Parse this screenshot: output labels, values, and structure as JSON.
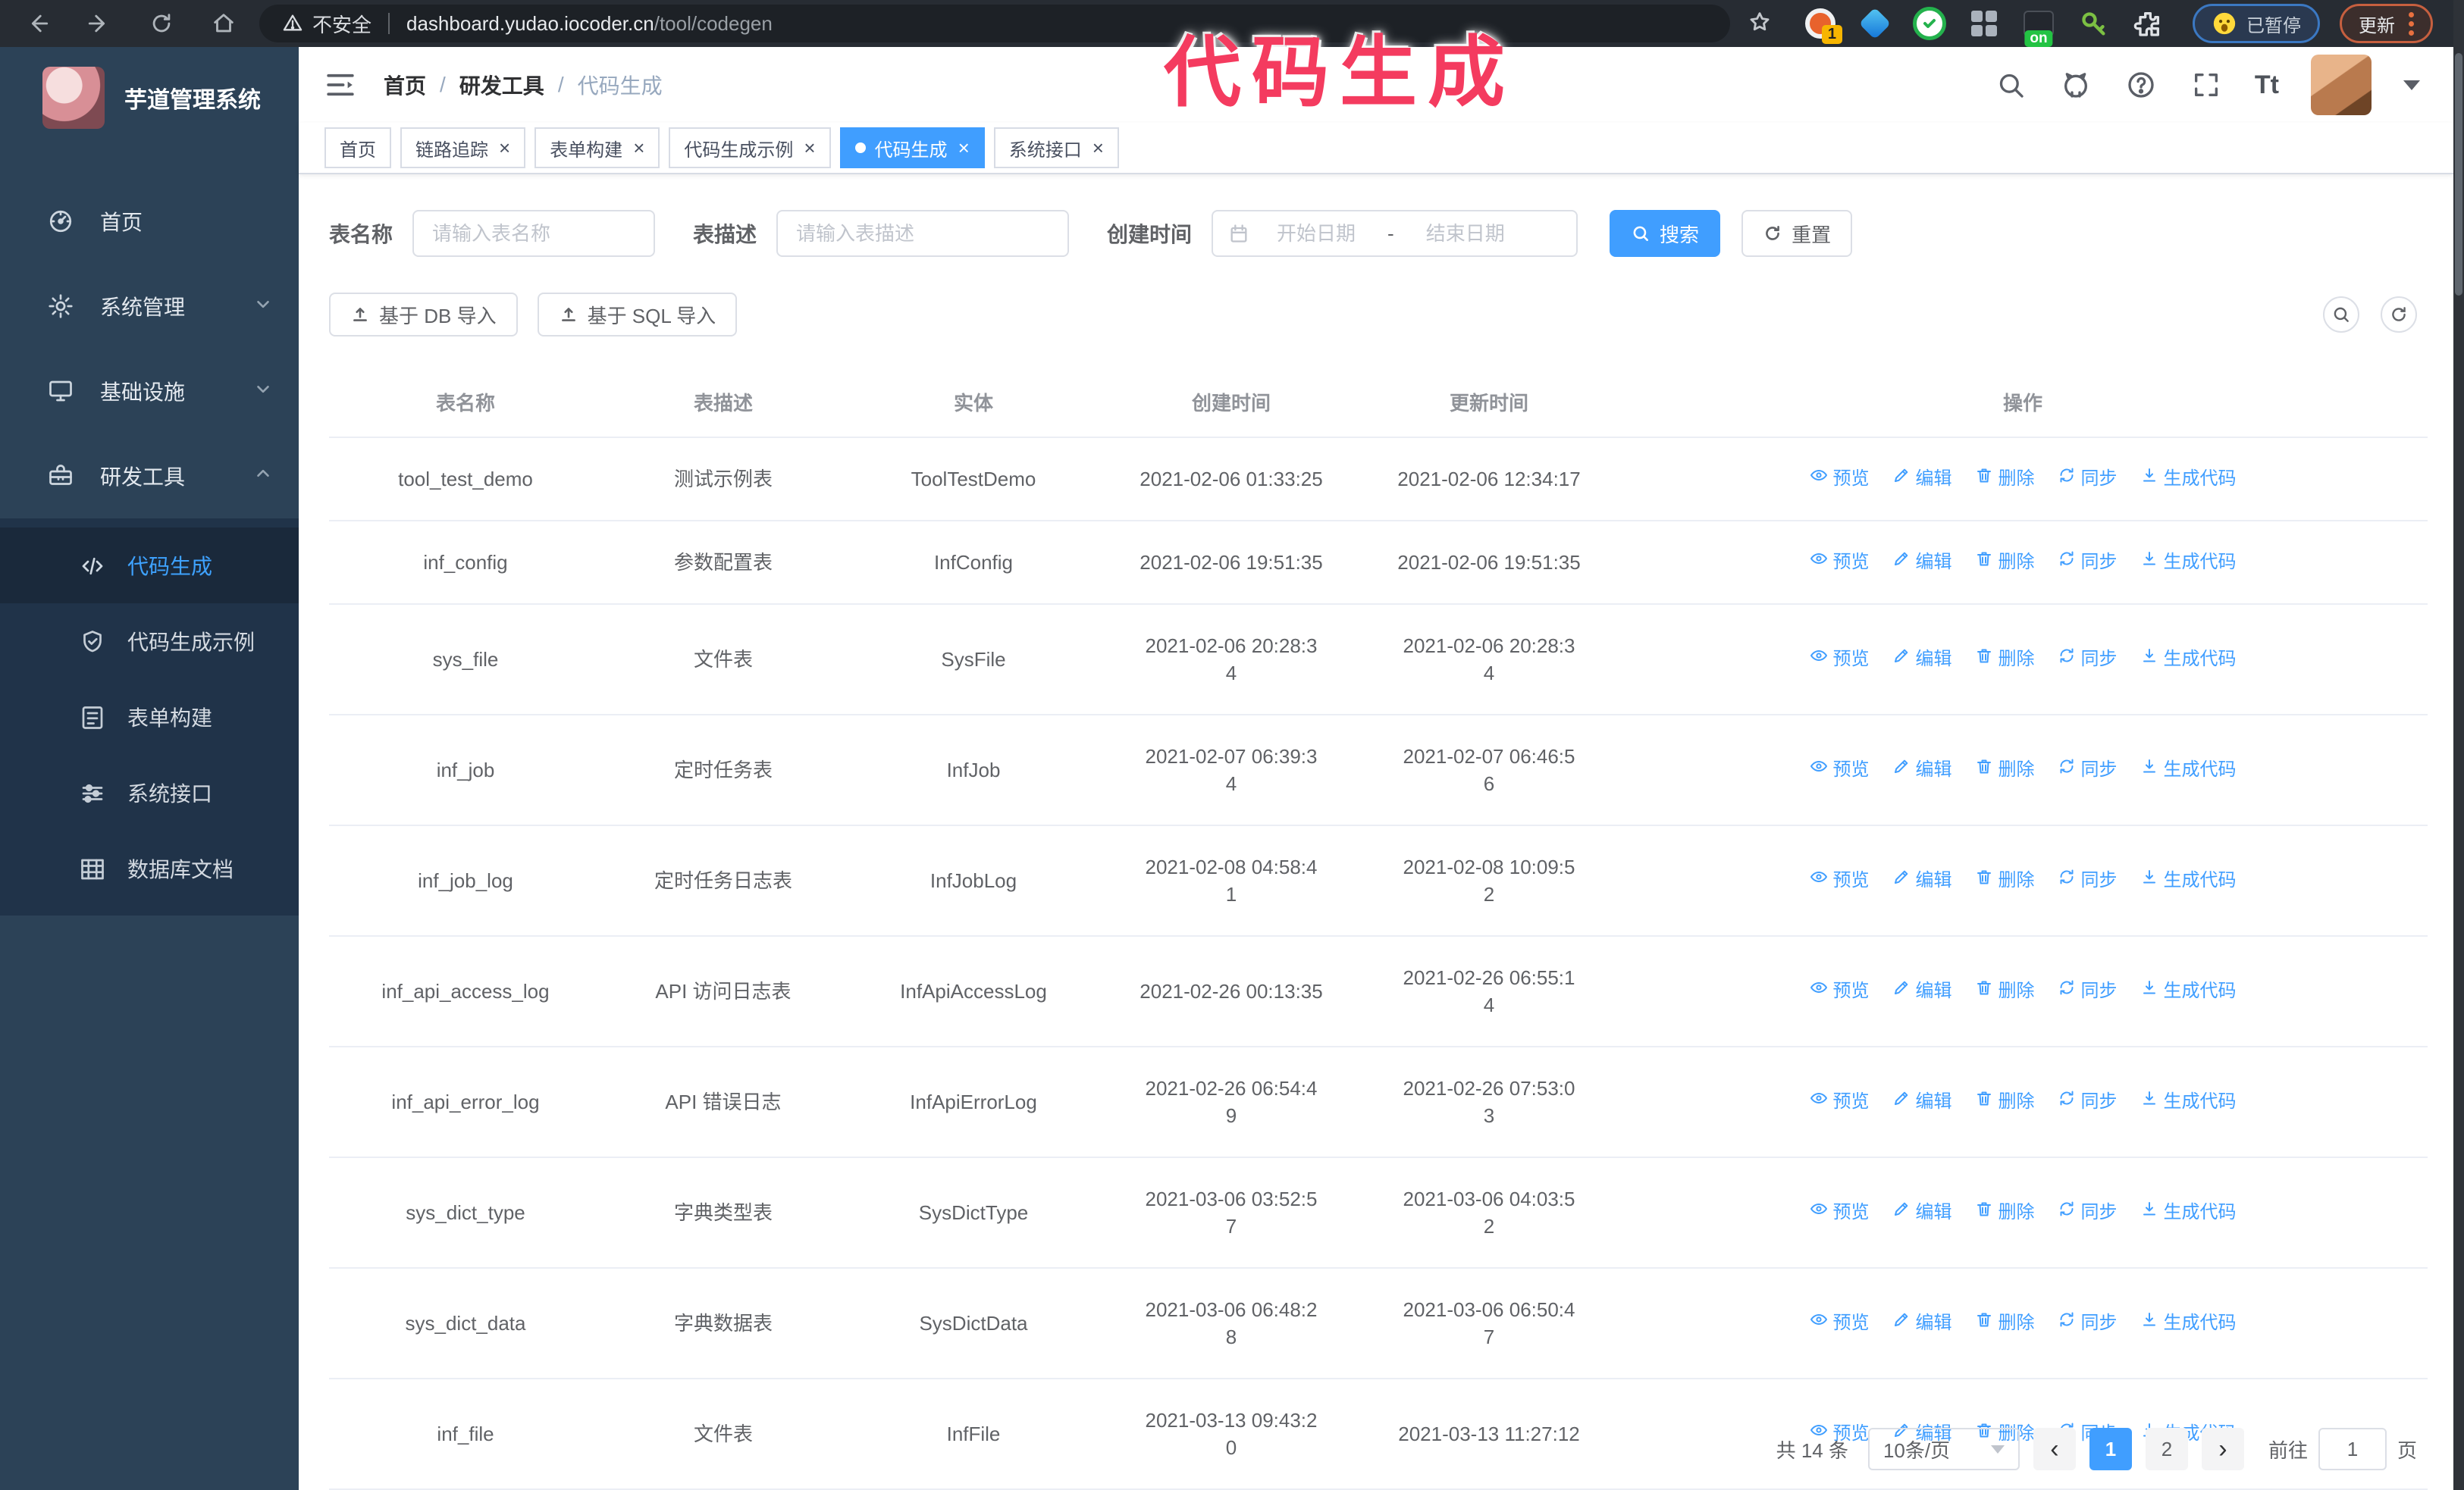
{
  "theme": {
    "accent": "#409eff",
    "sidebar_bg": "#2c4257",
    "submenu_bg": "#203349",
    "annotation_color": "#f43b5f",
    "browser_bar_bg": "#272c33"
  },
  "browser": {
    "security_label": "不安全",
    "url_domain": "dashboard.yudao.iocoder.cn",
    "url_path": "/tool/codegen",
    "extension_badge_1": "1",
    "extension_on_badge": "on",
    "paused_badge": "已暂停",
    "update_badge": "更新"
  },
  "annotation": {
    "text": "代码生成"
  },
  "sidebar": {
    "logo_title": "芋道管理系统",
    "menu": [
      {
        "id": "home",
        "label": "首页",
        "icon": "dashboard-icon",
        "chevron": ""
      },
      {
        "id": "system",
        "label": "系统管理",
        "icon": "gear-icon",
        "chevron": "down"
      },
      {
        "id": "infra",
        "label": "基础设施",
        "icon": "monitor-icon",
        "chevron": "down"
      },
      {
        "id": "devtools",
        "label": "研发工具",
        "icon": "toolbox-icon",
        "chevron": "up"
      }
    ],
    "submenu": [
      {
        "id": "codegen",
        "label": "代码生成",
        "icon": "code-icon",
        "active": true
      },
      {
        "id": "codegen-demo",
        "label": "代码生成示例",
        "icon": "shield-check-icon",
        "active": false
      },
      {
        "id": "form-builder",
        "label": "表单构建",
        "icon": "form-icon",
        "active": false
      },
      {
        "id": "system-api",
        "label": "系统接口",
        "icon": "sliders-icon",
        "active": false
      },
      {
        "id": "db-doc",
        "label": "数据库文档",
        "icon": "db-doc-icon",
        "active": false
      }
    ]
  },
  "header": {
    "breadcrumb": {
      "item1": "首页",
      "separator": "/",
      "item2": "研发工具",
      "item3": "代码生成"
    },
    "font_size_icon_text": "Tt"
  },
  "tabs": [
    {
      "id": "home",
      "label": "首页",
      "closable": false,
      "active": false
    },
    {
      "id": "trace",
      "label": "链路追踪",
      "closable": true,
      "active": false
    },
    {
      "id": "form-builder",
      "label": "表单构建",
      "closable": true,
      "active": false
    },
    {
      "id": "codegen-demo",
      "label": "代码生成示例",
      "closable": true,
      "active": false
    },
    {
      "id": "codegen",
      "label": "代码生成",
      "closable": true,
      "active": true
    },
    {
      "id": "system-api",
      "label": "系统接口",
      "closable": true,
      "active": false
    }
  ],
  "filters": {
    "name_label": "表名称",
    "name_placeholder": "请输入表名称",
    "desc_label": "表描述",
    "desc_placeholder": "请输入表描述",
    "time_label": "创建时间",
    "start_placeholder": "开始日期",
    "range_separator": "-",
    "end_placeholder": "结束日期",
    "search_label": "搜索",
    "reset_label": "重置"
  },
  "toolbar": {
    "import_db_label": "基于 DB 导入",
    "import_sql_label": "基于 SQL 导入"
  },
  "table": {
    "columns": [
      "表名称",
      "表描述",
      "实体",
      "创建时间",
      "更新时间",
      "操作"
    ],
    "actions": [
      {
        "id": "preview",
        "label": "预览",
        "icon": "eye-icon"
      },
      {
        "id": "edit",
        "label": "编辑",
        "icon": "pencil-icon"
      },
      {
        "id": "delete",
        "label": "删除",
        "icon": "trash-icon"
      },
      {
        "id": "sync",
        "label": "同步",
        "icon": "sync-icon"
      },
      {
        "id": "generate",
        "label": "生成代码",
        "icon": "download-icon"
      }
    ],
    "rows": [
      {
        "name": "tool_test_demo",
        "desc": "测试示例表",
        "entity": "ToolTestDemo",
        "created": "2021-02-06 01:33:25",
        "updated": "2021-02-06 12:34:17"
      },
      {
        "name": "inf_config",
        "desc": "参数配置表",
        "entity": "InfConfig",
        "created": "2021-02-06 19:51:35",
        "updated": "2021-02-06 19:51:35"
      },
      {
        "name": "sys_file",
        "desc": "文件表",
        "entity": "SysFile",
        "created": "2021-02-06 20:28:3\n4",
        "updated": "2021-02-06 20:28:3\n4"
      },
      {
        "name": "inf_job",
        "desc": "定时任务表",
        "entity": "InfJob",
        "created": "2021-02-07 06:39:3\n4",
        "updated": "2021-02-07 06:46:5\n6"
      },
      {
        "name": "inf_job_log",
        "desc": "定时任务日志表",
        "entity": "InfJobLog",
        "created": "2021-02-08 04:58:4\n1",
        "updated": "2021-02-08 10:09:5\n2"
      },
      {
        "name": "inf_api_access_log",
        "desc": "API 访问日志表",
        "entity": "InfApiAccessLog",
        "created": "2021-02-26 00:13:35",
        "updated": "2021-02-26 06:55:1\n4"
      },
      {
        "name": "inf_api_error_log",
        "desc": "API 错误日志",
        "entity": "InfApiErrorLog",
        "created": "2021-02-26 06:54:4\n9",
        "updated": "2021-02-26 07:53:0\n3"
      },
      {
        "name": "sys_dict_type",
        "desc": "字典类型表",
        "entity": "SysDictType",
        "created": "2021-03-06 03:52:5\n7",
        "updated": "2021-03-06 04:03:5\n2"
      },
      {
        "name": "sys_dict_data",
        "desc": "字典数据表",
        "entity": "SysDictData",
        "created": "2021-03-06 06:48:2\n8",
        "updated": "2021-03-06 06:50:4\n7"
      },
      {
        "name": "inf_file",
        "desc": "文件表",
        "entity": "InfFile",
        "created": "2021-03-13 09:43:2\n0",
        "updated": "2021-03-13 11:27:12"
      }
    ]
  },
  "pagination": {
    "total": "共 14 条",
    "page_size": "10条/页",
    "prev": "‹",
    "pages": [
      "1",
      "2"
    ],
    "active_page": "1",
    "next": "›",
    "goto_label": "前往",
    "goto_value": "1",
    "page_suffix": "页"
  }
}
